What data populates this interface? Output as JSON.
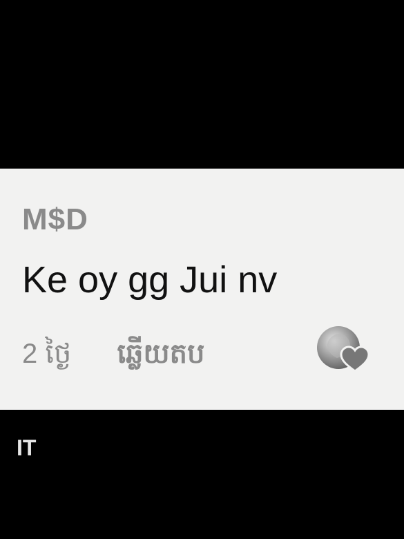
{
  "comment": {
    "author": "M$D",
    "text": "Ke oy gg Jui nv",
    "time_ago": "2 ថ្ងៃ",
    "reply_label": "ឆ្លើយតប",
    "liked_by_creator_icon": "creator-liked-heart-icon"
  },
  "footer": {
    "label": "IT"
  },
  "colors": {
    "background": "#000000",
    "card": "#f2f2f1",
    "author": "#8a8a8a",
    "text": "#111111",
    "heart": "#777777"
  }
}
